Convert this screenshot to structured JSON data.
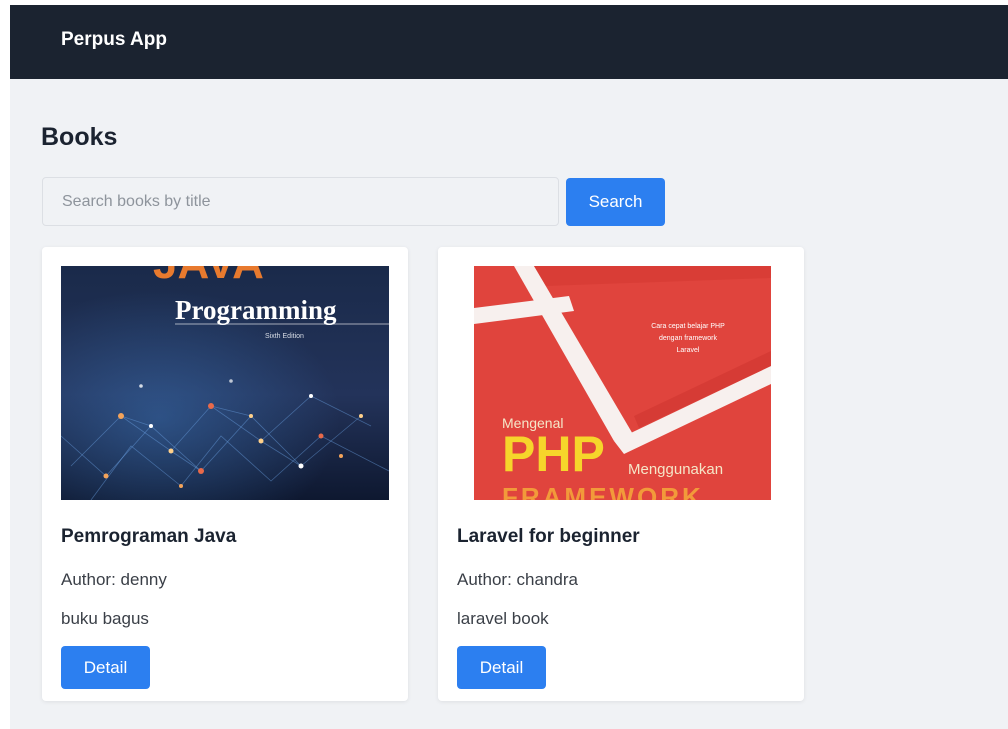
{
  "app": {
    "brand": "Perpus App"
  },
  "page": {
    "title": "Books"
  },
  "search": {
    "placeholder": "Search books by title",
    "value": "",
    "button_label": "Search"
  },
  "books": [
    {
      "title": "Pemrograman Java",
      "author": "Author: denny",
      "description": "buku bagus",
      "button_label": "Detail",
      "cover": {
        "big": "JAVA",
        "subtitle": "Programming",
        "edition": "Sixth Edition"
      }
    },
    {
      "title": "Laravel for beginner",
      "author": "Author: chandra",
      "description": "laravel book",
      "button_label": "Detail",
      "cover": {
        "tagline": [
          "Cara cepat belajar PHP",
          "dengan framework",
          "Laravel"
        ],
        "prefix": "Mengenal",
        "big": "PHP",
        "suffix": "Menggunakan",
        "bottom": "FRAMEWORK"
      }
    }
  ],
  "colors": {
    "navbar": "#1b2330",
    "background": "#f0f2f5",
    "primary": "#2c7ff0",
    "card": "#ffffff"
  }
}
